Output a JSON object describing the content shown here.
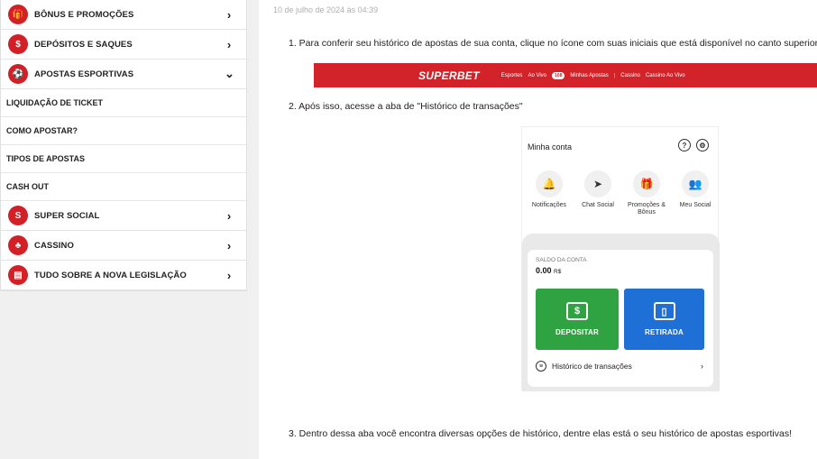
{
  "sidebar": {
    "items": [
      {
        "label": "BÔNUS E PROMOÇÕES",
        "icon": "gift-icon",
        "chevron": "›"
      },
      {
        "label": "DEPÓSITOS E SAQUES",
        "icon": "money-hand-icon",
        "chevron": "›"
      },
      {
        "label": "APOSTAS ESPORTIVAS",
        "icon": "soccer-ball-icon",
        "chevron": "⌄"
      }
    ],
    "subitems": [
      "LIQUIDAÇÃO DE TICKET",
      "COMO APOSTAR?",
      "TIPOS DE APOSTAS",
      "CASH OUT"
    ],
    "items_after": [
      {
        "label": "SUPER SOCIAL",
        "icon": "social-icon",
        "chevron": "›"
      },
      {
        "label": "CASSINO",
        "icon": "casino-chip-icon",
        "chevron": "›"
      },
      {
        "label": "TUDO SOBRE A NOVA LEGISLAÇÃO",
        "icon": "document-icon",
        "chevron": "›"
      }
    ]
  },
  "article": {
    "date": "10 de julho de 2024 às 04:39",
    "step1": "1. Para conferir seu histórico de apostas de sua conta, clique no ícone com suas iniciais que está disponível no canto superior",
    "step2": "2. Após isso, acesse a aba de \"Histórico de transações\"",
    "step3": "3. Dentro dessa aba você encontra diversas opções de histórico, dentre elas está o seu histórico de apostas esportivas!"
  },
  "banner": {
    "logo": "SUPERBET",
    "nav": [
      "Esportes",
      "Ao Vivo",
      "Minhas Apostas",
      "|",
      "Cassino",
      "Cassino Ao Vivo"
    ],
    "live_count": "108"
  },
  "phone": {
    "title": "Minha conta",
    "actions": [
      {
        "label": "Notificações",
        "icon": "bell-icon"
      },
      {
        "label": "Chat Social",
        "icon": "send-icon"
      },
      {
        "label": "Promoções & Bônus",
        "icon": "gift-icon"
      },
      {
        "label": "Meu Social",
        "icon": "people-icon"
      }
    ],
    "balance_label": "SALDO DA CONTA",
    "balance_value": "0.00",
    "currency": "R$",
    "deposit_label": "DEPOSITAR",
    "withdraw_label": "RETIRADA",
    "history_label": "Histórico de transações"
  },
  "colors": {
    "brand_red": "#d2232a",
    "deposit_green": "#2fa341",
    "withdraw_blue": "#1e70d6"
  }
}
